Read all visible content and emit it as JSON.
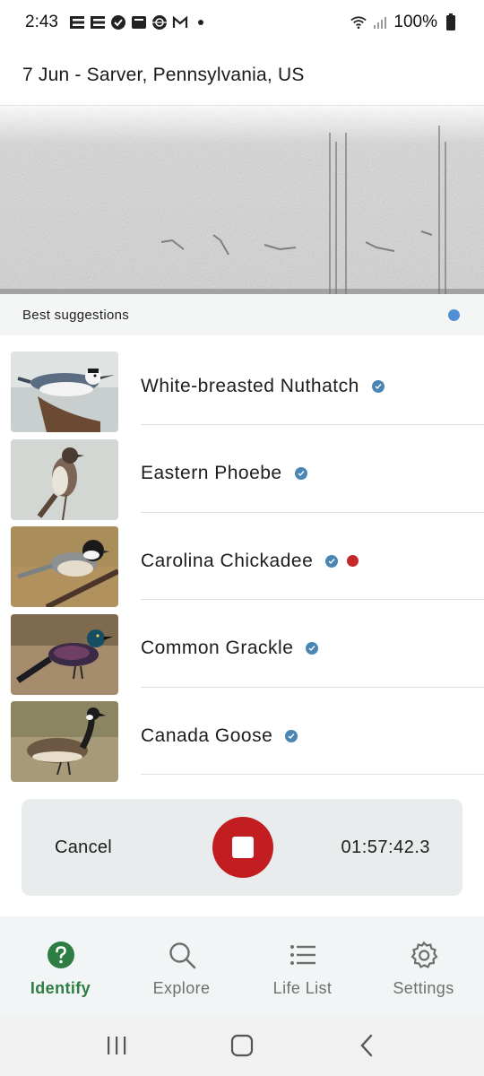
{
  "status_bar": {
    "time": "2:43",
    "battery": "100%",
    "left_icons": [
      "notification-e-icon",
      "notification-e-icon",
      "check-badge-icon",
      "wallet-icon",
      "globe-icon",
      "gmail-icon",
      "dot-icon"
    ],
    "right_icons": [
      "wifi-icon",
      "signal-icon",
      "battery-icon"
    ]
  },
  "header": {
    "location": "7 Jun - Sarver, Pennsylvania, US"
  },
  "suggestions": {
    "label": "Best suggestions",
    "indicator_color": "#4f8fd6"
  },
  "species": [
    {
      "name": "White-breasted Nuthatch",
      "verified": true,
      "flagged": false
    },
    {
      "name": "Eastern Phoebe",
      "verified": true,
      "flagged": false
    },
    {
      "name": "Carolina Chickadee",
      "verified": true,
      "flagged": true
    },
    {
      "name": "Common Grackle",
      "verified": true,
      "flagged": false
    },
    {
      "name": "Canada Goose",
      "verified": true,
      "flagged": false
    }
  ],
  "recorder": {
    "cancel_label": "Cancel",
    "elapsed": "01:57:42.3",
    "stop_color": "#c21e22"
  },
  "bottom_nav": {
    "items": [
      {
        "label": "Identify",
        "icon": "question-circle-icon",
        "active": true
      },
      {
        "label": "Explore",
        "icon": "search-icon",
        "active": false
      },
      {
        "label": "Life List",
        "icon": "list-icon",
        "active": false
      },
      {
        "label": "Settings",
        "icon": "gear-icon",
        "active": false
      }
    ],
    "active_color": "#2e7d43"
  },
  "system_nav": {
    "buttons": [
      "recent-apps-icon",
      "home-icon",
      "back-icon"
    ]
  }
}
